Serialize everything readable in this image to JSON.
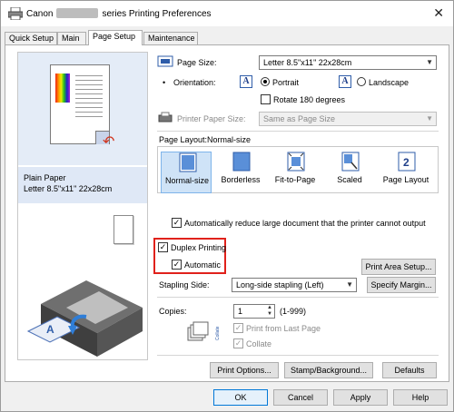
{
  "window": {
    "title_prefix": "Canon",
    "title_suffix": "series Printing Preferences",
    "close_glyph": "✕"
  },
  "tabs": [
    "Quick Setup",
    "Main",
    "Page Setup",
    "Maintenance"
  ],
  "active_tab": "Page Setup",
  "preview": {
    "media_line1": "Plain Paper",
    "media_line2": "Letter 8.5\"x11\" 22x28cm"
  },
  "page_size": {
    "label": "Page Size:",
    "value": "Letter 8.5\"x11\" 22x28cm"
  },
  "orientation": {
    "label": "Orientation:",
    "portrait": "Portrait",
    "landscape": "Landscape",
    "selected": "Portrait",
    "rotate_label": "Rotate 180 degrees",
    "rotate_checked": false
  },
  "printer_paper_size": {
    "label": "Printer Paper Size:",
    "value": "Same as Page Size",
    "enabled": false
  },
  "page_layout": {
    "heading": "Page Layout:Normal-size",
    "options": [
      "Normal-size",
      "Borderless",
      "Fit-to-Page",
      "Scaled",
      "Page Layout"
    ],
    "selected": "Normal-size",
    "auto_reduce_label": "Automatically reduce large document that the printer cannot output",
    "auto_reduce_checked": true
  },
  "duplex": {
    "label": "Duplex Printing",
    "checked": true,
    "automatic_label": "Automatic",
    "automatic_checked": true,
    "print_area_button": "Print Area Setup..."
  },
  "stapling": {
    "label": "Stapling Side:",
    "value": "Long-side stapling (Left)",
    "specify_margin_button": "Specify Margin..."
  },
  "copies": {
    "label": "Copies:",
    "value": "1",
    "range": "(1-999)",
    "print_from_last_label": "Print from Last Page",
    "collate_label": "Collate"
  },
  "bottom_buttons": {
    "print_options": "Print Options...",
    "stamp_background": "Stamp/Background...",
    "defaults": "Defaults"
  },
  "dialog_buttons": {
    "ok": "OK",
    "cancel": "Cancel",
    "apply": "Apply",
    "help": "Help"
  },
  "colors": {
    "highlight_box": "#e0211b",
    "accent_blue": "#2f5da9",
    "selected_item": "#cfe3f7"
  }
}
